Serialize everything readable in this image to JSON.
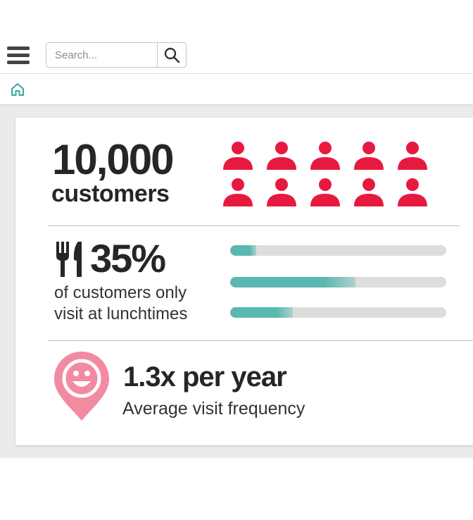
{
  "header": {
    "search": {
      "placeholder": "Search..."
    }
  },
  "stats": {
    "customers": {
      "value": "10,000",
      "label": "customers",
      "icon_count": 10,
      "icon_color": "#e8193f"
    },
    "lunchtime": {
      "value": "35%",
      "description_line1": "of customers only",
      "description_line2": "visit at lunchtimes",
      "bar_color": "#5bb8b0",
      "bars": [
        0.12,
        0.58,
        0.29
      ]
    },
    "frequency": {
      "value": "1.3x per year",
      "description": "Average visit frequency",
      "pin_color": "#f28aa2"
    }
  },
  "colors": {
    "accent": "#5bb8b0",
    "people": "#e8193f",
    "text": "#262626"
  }
}
